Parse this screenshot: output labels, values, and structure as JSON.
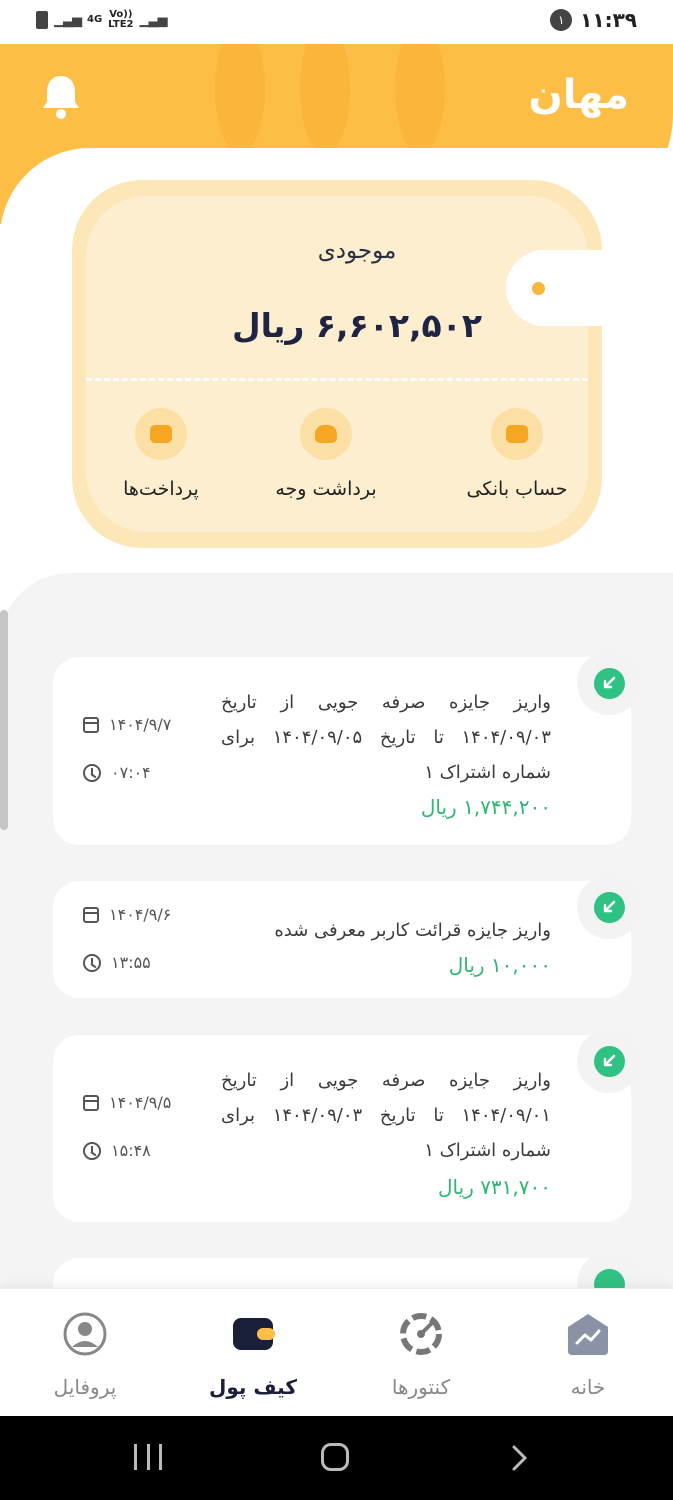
{
  "status_bar": {
    "network_top": "4G",
    "network_volte": "Vo))",
    "network_lte": "LTE2",
    "notification_count": "۱",
    "time": "۱۱:۳۹"
  },
  "header": {
    "logo": "مهان",
    "brand_color": "#fdbe46"
  },
  "wallet": {
    "balance_label": "موجودی",
    "balance_amount": "۶,۶۰۲,۵۰۲ ریال",
    "actions": [
      {
        "label": "حساب بانکی",
        "icon": "bank-card-icon"
      },
      {
        "label": "برداشت وجه",
        "icon": "wallet-withdraw-icon"
      },
      {
        "label": "پرداخت‌ها",
        "icon": "payments-list-icon"
      }
    ]
  },
  "transactions": [
    {
      "description": "واریز جایزه صرفه جویی از تاریخ ۱۴۰۴/۰۹/۰۳ تا تاریخ ۱۴۰۴/۰۹/۰۵ برای شماره اشتراک ۱",
      "amount": "۱,۷۴۴,۲۰۰ ریال",
      "date": "۱۴۰۴/۹/۷",
      "time": "۰۷:۰۴"
    },
    {
      "description": "واریز جایزه قرائت کاربر معرفی شده",
      "amount": "۱۰,۰۰۰ ریال",
      "date": "۱۴۰۴/۹/۶",
      "time": "۱۳:۵۵"
    },
    {
      "description": "واریز جایزه صرفه جویی از تاریخ ۱۴۰۴/۰۹/۰۱ تا تاریخ ۱۴۰۴/۰۹/۰۳ برای شماره اشتراک ۱",
      "amount": "۷۳۱,۷۰۰ ریال",
      "date": "۱۴۰۴/۹/۵",
      "time": "۱۵:۴۸"
    }
  ],
  "bottom_nav": {
    "items": [
      {
        "label": "خانه",
        "icon": "home-chart-icon",
        "active": false
      },
      {
        "label": "کنتورها",
        "icon": "gauge-icon",
        "active": false
      },
      {
        "label": "کیف پول",
        "icon": "wallet-icon",
        "active": true
      },
      {
        "label": "پروفایل",
        "icon": "profile-icon",
        "active": false
      }
    ]
  },
  "colors": {
    "accent": "#fdbe46",
    "positive": "#30c283",
    "dark": "#1a1f3a"
  }
}
